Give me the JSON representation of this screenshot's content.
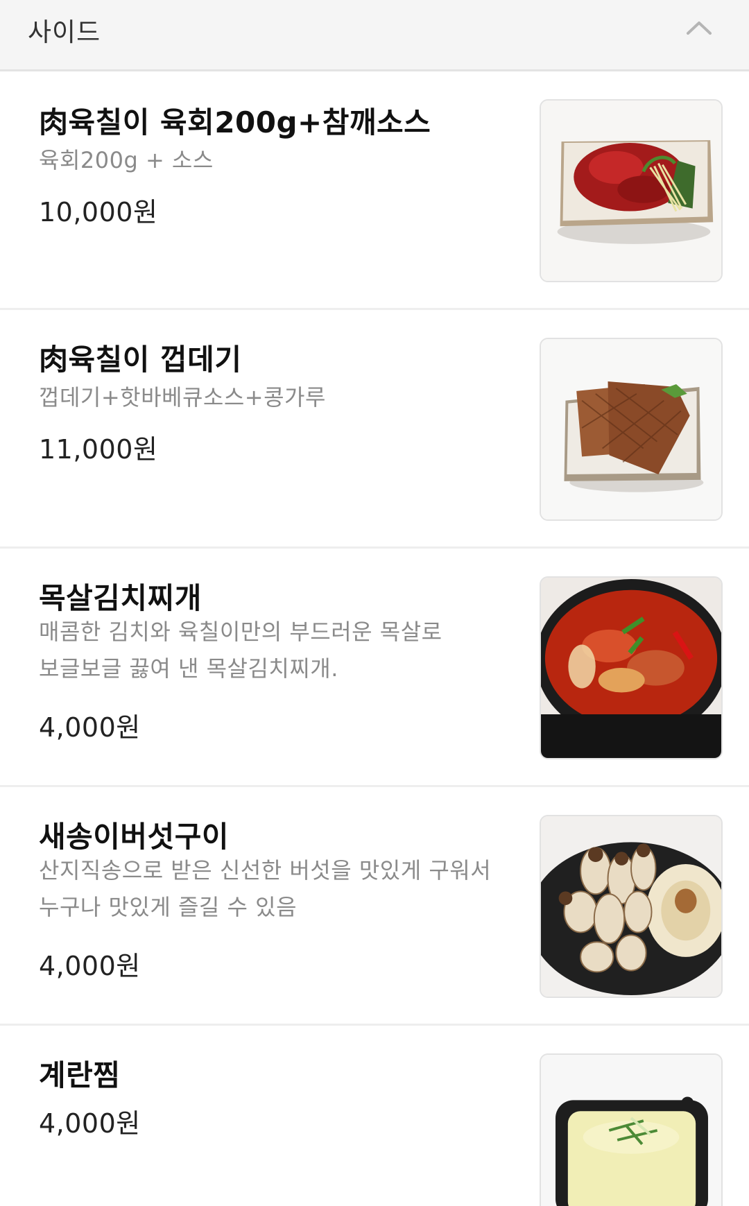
{
  "section": {
    "title": "사이드",
    "toggle_icon": "chevron-up-icon"
  },
  "items": [
    {
      "name": "肉육칠이 육회200g+참깨소스",
      "description": "육회200g + 소스",
      "price": "10,000원",
      "image": "beef-tartare-photo"
    },
    {
      "name": "肉육칠이 껍데기",
      "description": "껍데기+핫바베큐소스+콩가루",
      "price": "11,000원",
      "image": "pork-skin-photo"
    },
    {
      "name": "목살김치찌개",
      "description_lines": [
        "매콤한 김치와 육칠이만의 부드러운 목살로",
        "보글보글 끓여 낸 목살김치찌개."
      ],
      "price": "4,000원",
      "image": "kimchi-stew-photo"
    },
    {
      "name": "새송이버섯구이",
      "description_lines": [
        "산지직송으로 받은 신선한 버섯을 맛있게 구워서",
        "누구나 맛있게 즐길 수 있음"
      ],
      "price": "4,000원",
      "image": "grilled-mushroom-photo"
    },
    {
      "name": "계란찜",
      "price": "4,000원",
      "image": "steamed-egg-photo"
    }
  ]
}
